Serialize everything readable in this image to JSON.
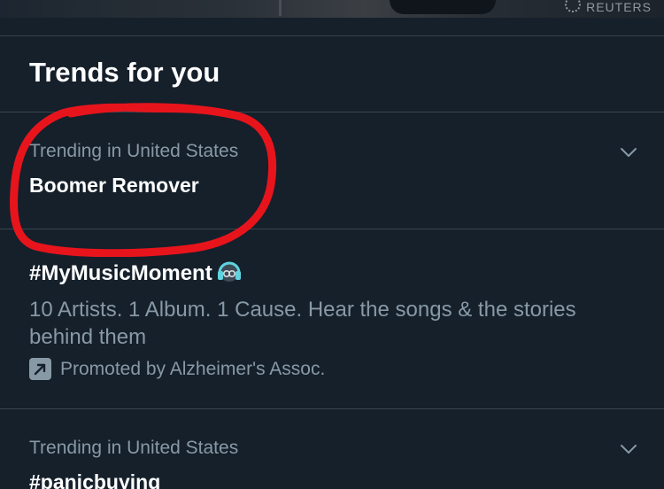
{
  "photo_credit": "REUTERS",
  "section": {
    "title": "Trends for you"
  },
  "trends": [
    {
      "meta": "Trending in United States",
      "name": "Boomer Remover"
    },
    {
      "name": "#MyMusicMoment",
      "description": "10 Artists. 1 Album. 1 Cause. Hear the songs & the stories behind them",
      "promoted": "Promoted by Alzheimer's Assoc."
    },
    {
      "meta": "Trending in United States",
      "name": "#panicbuying"
    }
  ],
  "icons": {
    "chevron": "chevron-down-icon",
    "promoted": "promoted-arrow-icon",
    "emoji": "headphones-emoji-icon",
    "photo_logo": "reuters-logo-icon"
  },
  "colors": {
    "background": "#15202b",
    "divider": "#38444d",
    "secondary_text": "#8899a6",
    "primary_text": "#ffffff",
    "annotation": "#e8141c",
    "accent": "#1da1f2"
  }
}
